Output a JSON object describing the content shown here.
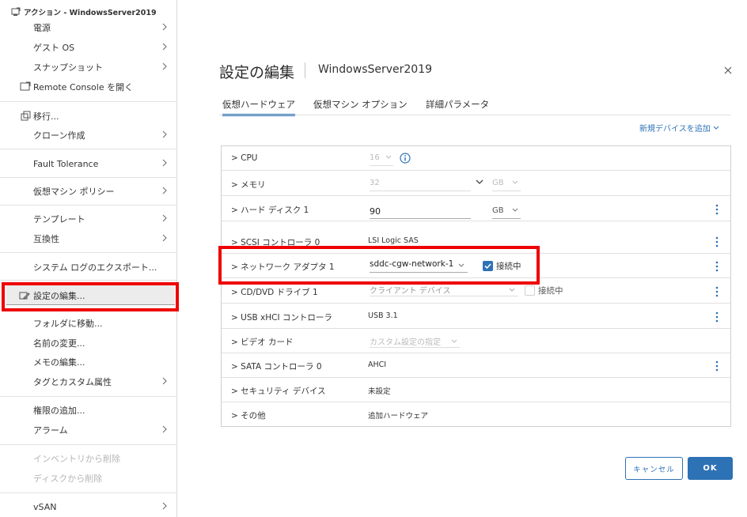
{
  "menu": {
    "title": "アクション - WindowsServer2019",
    "items": [
      {
        "label": "電源",
        "submenu": true
      },
      {
        "label": "ゲスト OS",
        "submenu": true
      },
      {
        "label": "スナップショット",
        "submenu": true
      },
      {
        "label": "Remote Console を開く",
        "submenu": false
      },
      {
        "label": "移行...",
        "submenu": false
      },
      {
        "label": "クローン作成",
        "submenu": true
      },
      {
        "label": "Fault Tolerance",
        "submenu": true
      },
      {
        "label": "仮想マシン ポリシー",
        "submenu": true
      },
      {
        "label": "テンプレート",
        "submenu": true
      },
      {
        "label": "互換性",
        "submenu": true
      },
      {
        "label": "システム ログのエクスポート...",
        "submenu": false
      },
      {
        "label": "設定の編集...",
        "submenu": false
      },
      {
        "label": "フォルダに移動...",
        "submenu": false
      },
      {
        "label": "名前の変更...",
        "submenu": false
      },
      {
        "label": "メモの編集...",
        "submenu": false
      },
      {
        "label": "タグとカスタム属性",
        "submenu": true
      },
      {
        "label": "権限の追加...",
        "submenu": false
      },
      {
        "label": "アラーム",
        "submenu": true
      },
      {
        "label": "インベントリから削除",
        "submenu": false,
        "disabled": true
      },
      {
        "label": "ディスクから削除",
        "submenu": false,
        "disabled": true
      },
      {
        "label": "vSAN",
        "submenu": true
      }
    ]
  },
  "dialog": {
    "title": "設定の編集",
    "vm_name": "WindowsServer2019",
    "tabs": [
      "仮想ハードウェア",
      "仮想マシン オプション",
      "詳細パラメータ"
    ],
    "active_tab": 0,
    "add_device": "新規デバイスを追加",
    "rows": [
      {
        "label": "CPU",
        "value": "16"
      },
      {
        "label": "メモリ",
        "value": "32",
        "unit": "GB"
      },
      {
        "label": "ハード ディスク 1",
        "value": "90",
        "unit": "GB"
      },
      {
        "label": "SCSI コントローラ 0",
        "value": "LSI Logic SAS"
      },
      {
        "label": "ネットワーク アダプタ 1",
        "value": "sddc-cgw-network-1",
        "connect_label": "接続中",
        "connected": true
      },
      {
        "label": "CD/DVD ドライブ 1",
        "value": "クライアント デバイス",
        "connect_label": "接続中",
        "connected": false
      },
      {
        "label": "USB xHCI コントローラ",
        "value": "USB 3.1"
      },
      {
        "label": "ビデオ カード",
        "value": "カスタム設定の指定"
      },
      {
        "label": "SATA コントローラ 0",
        "value": "AHCI"
      },
      {
        "label": "セキュリティ デバイス",
        "value": "未設定"
      },
      {
        "label": "その他",
        "value": "追加ハードウェア"
      }
    ],
    "cancel_label": "キャンセル",
    "ok_label": "OK"
  },
  "colors": {
    "accent": "#2d72b5",
    "highlight": "#ee0000"
  }
}
